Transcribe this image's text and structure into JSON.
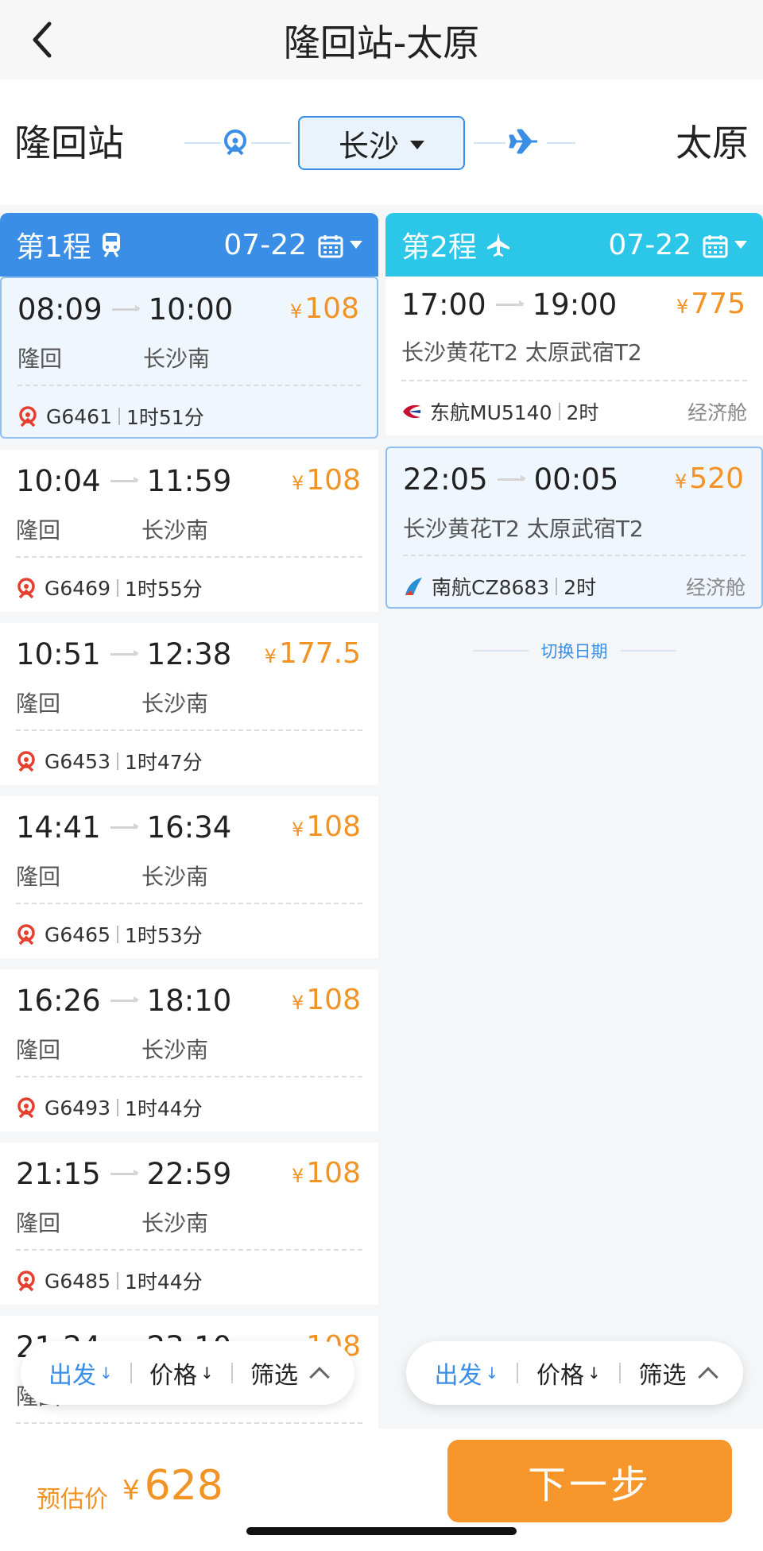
{
  "nav": {
    "title": "隆回站-太原"
  },
  "route": {
    "from": "隆回站",
    "via": "长沙",
    "to": "太原"
  },
  "legs": [
    {
      "label": "第1程",
      "date": "07-22",
      "mode": "train",
      "items": [
        {
          "depart": "08:09",
          "arrive": "10:00",
          "price": "108",
          "from": "隆回",
          "to": "长沙南",
          "code": "G6461",
          "duration": "1时51分"
        },
        {
          "depart": "10:04",
          "arrive": "11:59",
          "price": "108",
          "from": "隆回",
          "to": "长沙南",
          "code": "G6469",
          "duration": "1时55分"
        },
        {
          "depart": "10:51",
          "arrive": "12:38",
          "price": "177.5",
          "from": "隆回",
          "to": "长沙南",
          "code": "G6453",
          "duration": "1时47分"
        },
        {
          "depart": "14:41",
          "arrive": "16:34",
          "price": "108",
          "from": "隆回",
          "to": "长沙南",
          "code": "G6465",
          "duration": "1时53分"
        },
        {
          "depart": "16:26",
          "arrive": "18:10",
          "price": "108",
          "from": "隆回",
          "to": "长沙南",
          "code": "G6493",
          "duration": "1时44分"
        },
        {
          "depart": "21:15",
          "arrive": "22:59",
          "price": "108",
          "from": "隆回",
          "to": "长沙南",
          "code": "G6485",
          "duration": "1时44分"
        },
        {
          "depart": "21:24",
          "arrive": "23:10",
          "price": "108",
          "from": "隆回",
          "to": "",
          "code": "",
          "duration": ""
        }
      ]
    },
    {
      "label": "第2程",
      "date": "07-22",
      "mode": "flight",
      "items": [
        {
          "depart": "17:00",
          "arrive": "19:00",
          "price": "775",
          "terminals": "长沙黄花T2 太原武宿T2",
          "airline": "东航MU5140",
          "duration": "2时",
          "cabin": "经济舱"
        },
        {
          "depart": "22:05",
          "arrive": "00:05",
          "price": "520",
          "terminals": "长沙黄花T2 太原武宿T2",
          "airline": "南航CZ8683",
          "duration": "2时",
          "cabin": "经济舱"
        }
      ],
      "switch_date": "切换日期"
    }
  ],
  "sortbar": {
    "depart": "出发",
    "price": "价格",
    "filter": "筛选"
  },
  "bottom": {
    "est_label": "预估价",
    "currency": "¥",
    "est_value": "628",
    "next": "下一步"
  },
  "currency": "¥",
  "colors": {
    "blue": "#3a8ee6",
    "cyan": "#2bc6e8",
    "orange": "#f29325",
    "button": "#f7962b"
  }
}
